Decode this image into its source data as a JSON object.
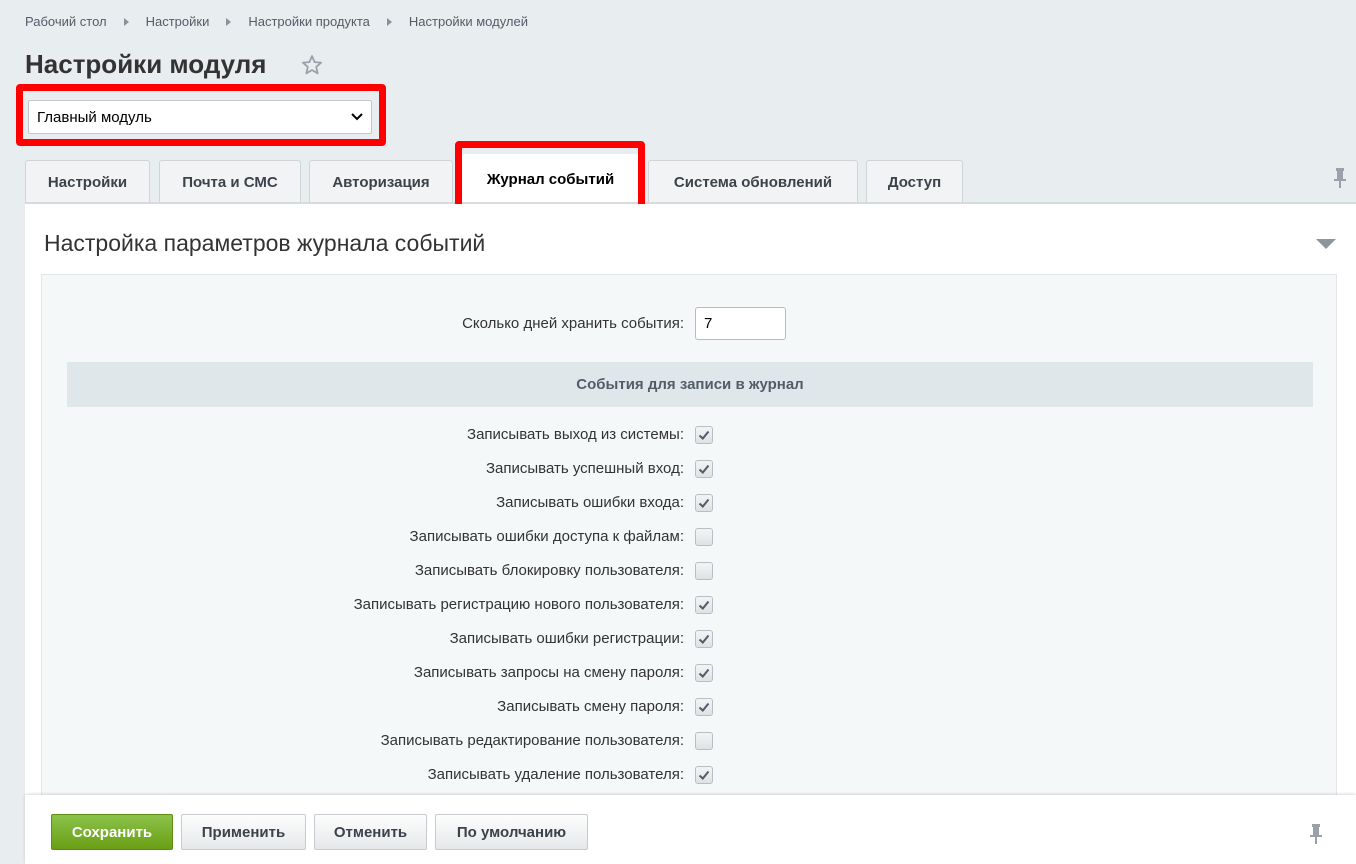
{
  "breadcrumb": [
    "Рабочий стол",
    "Настройки",
    "Настройки продукта",
    "Настройки модулей"
  ],
  "page_title": "Настройки модуля",
  "module_select": {
    "value": "Главный модуль"
  },
  "tabs": [
    {
      "label": "Настройки",
      "active": false
    },
    {
      "label": "Почта и СМС",
      "active": false
    },
    {
      "label": "Авторизация",
      "active": false
    },
    {
      "label": "Журнал событий",
      "active": true
    },
    {
      "label": "Система обновлений",
      "active": false
    },
    {
      "label": "Доступ",
      "active": false
    }
  ],
  "panel": {
    "title": "Настройка параметров журнала событий",
    "days_label": "Сколько дней хранить события:",
    "days_value": "7",
    "section_title": "События для записи в журнал",
    "checkboxes": [
      {
        "label": "Записывать выход из системы:",
        "checked": true
      },
      {
        "label": "Записывать успешный вход:",
        "checked": true
      },
      {
        "label": "Записывать ошибки входа:",
        "checked": true
      },
      {
        "label": "Записывать ошибки доступа к файлам:",
        "checked": false
      },
      {
        "label": "Записывать блокировку пользователя:",
        "checked": false
      },
      {
        "label": "Записывать регистрацию нового пользователя:",
        "checked": true
      },
      {
        "label": "Записывать ошибки регистрации:",
        "checked": true
      },
      {
        "label": "Записывать запросы на смену пароля:",
        "checked": true
      },
      {
        "label": "Записывать смену пароля:",
        "checked": true
      },
      {
        "label": "Записывать редактирование пользователя:",
        "checked": false
      },
      {
        "label": "Записывать удаление пользователя:",
        "checked": true
      }
    ]
  },
  "footer": {
    "save": "Сохранить",
    "apply": "Применить",
    "cancel": "Отменить",
    "default": "По умолчанию"
  },
  "colors": {
    "highlight": "#ff0000",
    "save_button": "#7cb518"
  }
}
